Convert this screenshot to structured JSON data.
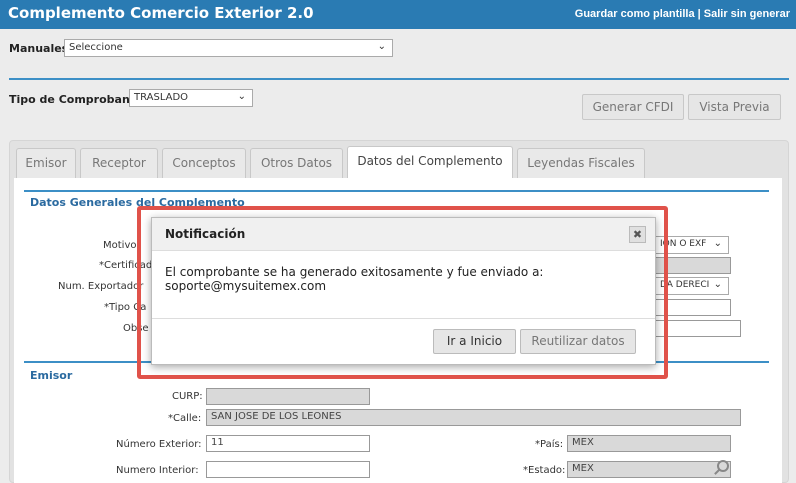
{
  "header": {
    "title": "Complemento Comercio Exterior 2.0",
    "save_template": "Guardar como plantilla",
    "separator": "|",
    "exit": "Salir sin generar"
  },
  "manuales": {
    "label": "Manuales:",
    "value": "Seleccione"
  },
  "tipo": {
    "label": "Tipo de Comprobante:",
    "value": "TRASLADO"
  },
  "actions": {
    "generate": "Generar CFDI",
    "preview": "Vista Previa"
  },
  "tabs": [
    {
      "label": "Emisor"
    },
    {
      "label": "Receptor"
    },
    {
      "label": "Conceptos"
    },
    {
      "label": "Otros Datos"
    },
    {
      "label": "Datos del Complemento"
    },
    {
      "label": "Leyendas Fiscales"
    }
  ],
  "datos_generales": {
    "section_title": "Datos Generales del Complemento",
    "motivo_label": "Motivo",
    "motivo_value": "ION O EXF",
    "certificado_label": "*Certificad",
    "num_exportador_label": "Num. Exportador",
    "num_exportador_value": "DA DERECI",
    "tipo_cambio_label": "*Tipo Ca",
    "observaciones_label": "Obse"
  },
  "emisor": {
    "section_title": "Emisor",
    "curp_label": "CURP:",
    "curp_value": "",
    "calle_label": "*Calle:",
    "calle_value": "SAN JOSE DE LOS LEONES",
    "num_ext_label": "Número Exterior:",
    "num_ext_value": "11",
    "num_int_label": "Numero Interior:",
    "num_int_value": "",
    "pais_label": "*País:",
    "pais_value": "MEX",
    "estado_label": "*Estado:",
    "estado_value": "MEX"
  },
  "modal": {
    "title": "Notificación",
    "close": "✖",
    "message_line1": "El comprobante se ha generado exitosamente y fue enviado a:",
    "message_line2": "soporte@mysuitemex.com",
    "home_button": "Ir a Inicio",
    "reuse_button": "Reutilizar datos"
  },
  "colors": {
    "header_bg": "#2a7bb3",
    "accent_line": "#3c8fc6",
    "highlight_outline": "#e0524a"
  }
}
